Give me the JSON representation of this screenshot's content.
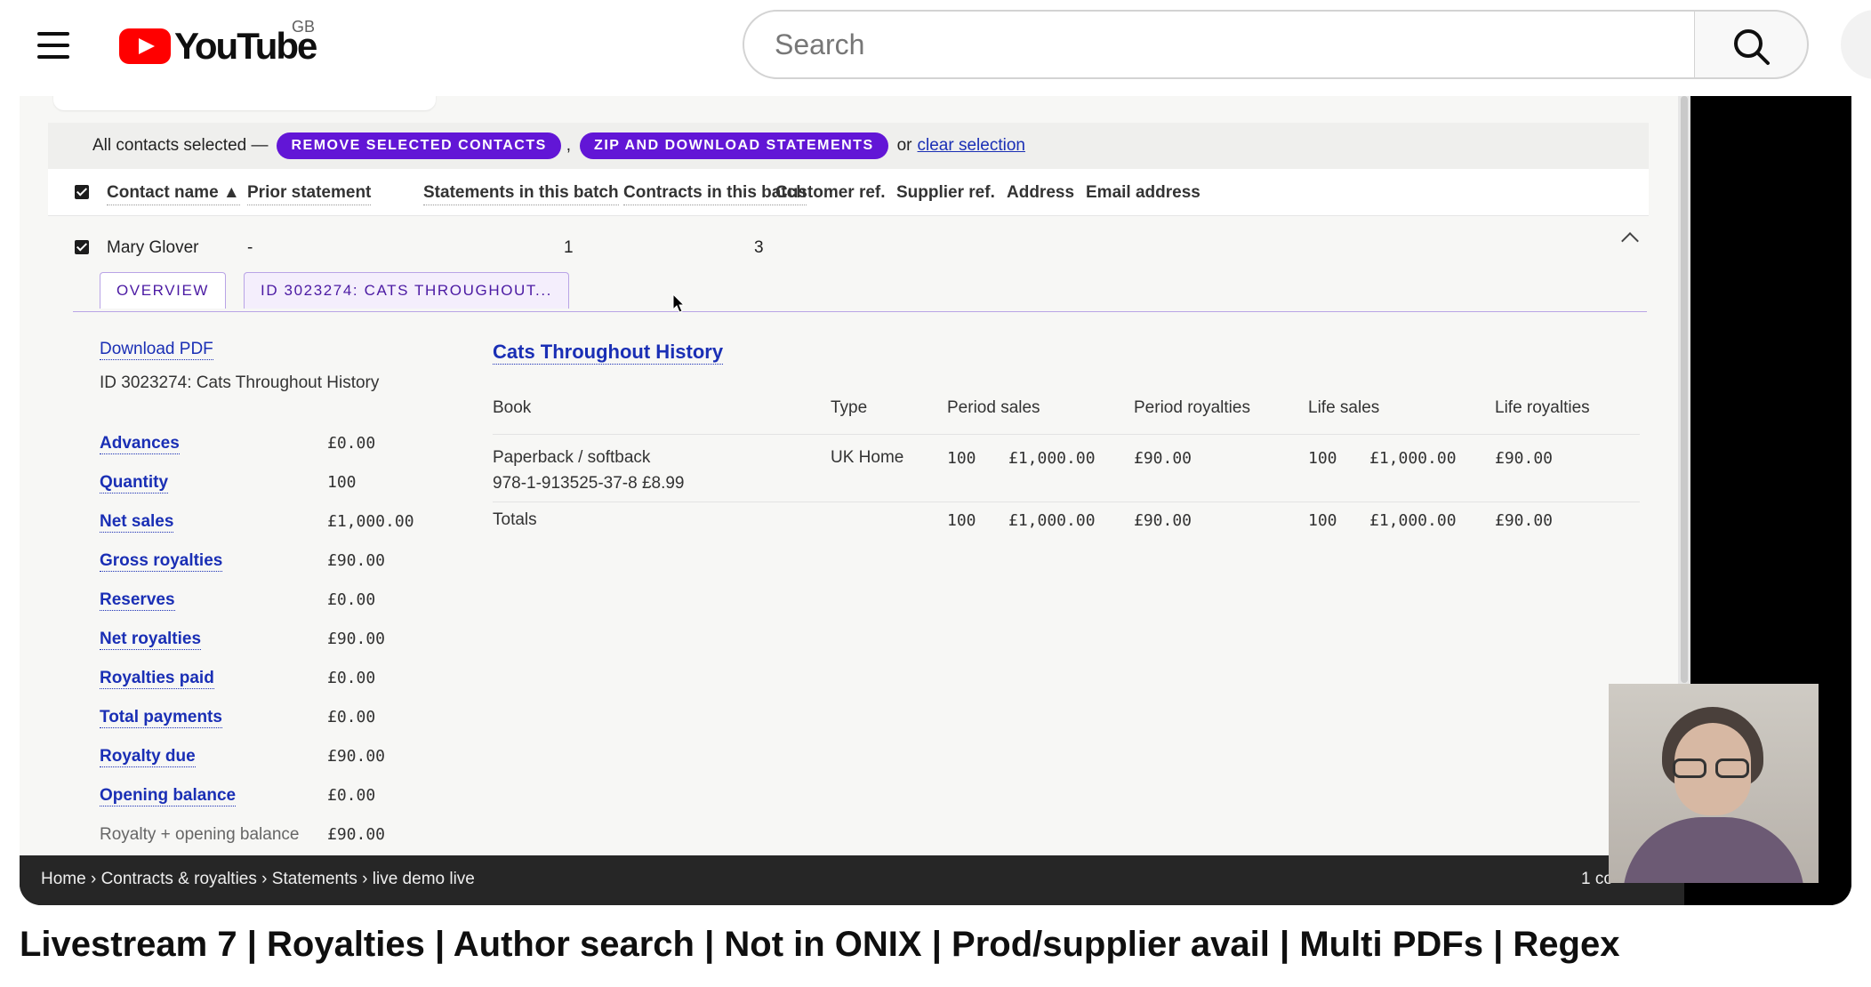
{
  "youtube": {
    "logo_text": "YouTube",
    "region": "GB",
    "search_placeholder": "Search"
  },
  "selection_bar": {
    "lead": "All contacts selected —",
    "remove_button": "REMOVE SELECTED CONTACTS",
    "separator": ",",
    "zip_button": "ZIP AND DOWNLOAD STATEMENTS",
    "or": "or",
    "clear_link": "clear selection"
  },
  "table_headers": {
    "contact_name": "Contact name ▲",
    "prior_statement": "Prior statement",
    "statements": "Statements in this batch",
    "contracts": "Contracts in this batch",
    "customer_ref": "Customer ref.",
    "supplier_ref": "Supplier ref.",
    "address": "Address",
    "email": "Email address"
  },
  "contact_row": {
    "name": "Mary Glover",
    "prior_statement": "-",
    "statements": "1",
    "contracts": "3"
  },
  "tabs": {
    "overview": "OVERVIEW",
    "contract": "ID 3023274: CATS THROUGHOUT..."
  },
  "statement_summary": {
    "download_pdf": "Download PDF",
    "id_line": "ID 3023274: Cats Throughout History",
    "rows": [
      {
        "label": "Advances",
        "value": "£0.00"
      },
      {
        "label": "Quantity",
        "value": "100"
      },
      {
        "label": "Net sales",
        "value": "£1,000.00"
      },
      {
        "label": "Gross royalties",
        "value": "£90.00"
      },
      {
        "label": "Reserves",
        "value": "£0.00"
      },
      {
        "label": "Net royalties",
        "value": "£90.00"
      },
      {
        "label": "Royalties paid",
        "value": "£0.00"
      },
      {
        "label": "Total payments",
        "value": "£0.00"
      },
      {
        "label": "Royalty due",
        "value": "£90.00"
      },
      {
        "label": "Opening balance",
        "value": "£0.00"
      },
      {
        "label": "Royalty + opening balance",
        "value": "£90.00"
      }
    ]
  },
  "book_table": {
    "title": "Cats Throughout History",
    "headers": {
      "book": "Book",
      "type": "Type",
      "period_sales": "Period sales",
      "period_royalties": "Period royalties",
      "life_sales": "Life sales",
      "life_royalties": "Life royalties"
    },
    "row": {
      "book_line1": "Paperback / softback",
      "book_line2": "978-1-913525-37-8 £8.99",
      "type": "UK Home",
      "period_qty": "100",
      "period_value": "£1,000.00",
      "period_royalties": "£90.00",
      "life_qty": "100",
      "life_value": "£1,000.00",
      "life_royalties": "£90.00"
    },
    "totals": {
      "label": "Totals",
      "period_qty": "100",
      "period_value": "£1,000.00",
      "period_royalties": "£90.00",
      "life_qty": "100",
      "life_value": "£1,000.00",
      "life_royalties": "£90.00"
    }
  },
  "breadcrumb": {
    "home": "Home",
    "contracts": "Contracts & royalties",
    "statements": "Statements",
    "current": "live demo live",
    "sep": "›",
    "count": "1 co"
  },
  "video_title": "Livestream 7 | Royalties | Author search | Not in ONIX | Prod/supplier avail | Multi PDFs | Regex"
}
